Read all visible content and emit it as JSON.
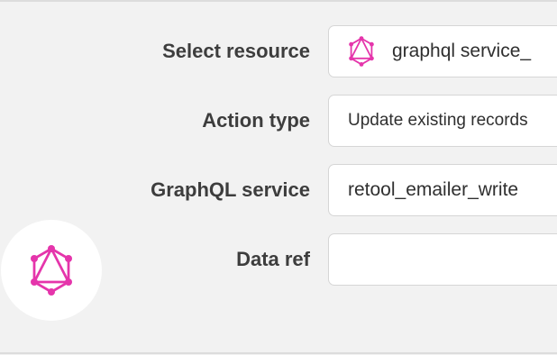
{
  "form": {
    "rows": [
      {
        "label": "Select resource",
        "value": "graphql service_",
        "icon": "graphql-icon"
      },
      {
        "label": "Action type",
        "value": "Update existing records"
      },
      {
        "label": "GraphQL service",
        "value": "retool_emailer_write"
      },
      {
        "label": "Data ref",
        "value": ""
      }
    ]
  },
  "logo": {
    "icon": "graphql-icon",
    "color": "#e535ab"
  },
  "colors": {
    "background": "#f2f2f2",
    "field_background": "#ffffff",
    "field_border": "#d6d6d6",
    "label_text": "#3d3d3d",
    "graphql_pink": "#e535ab"
  }
}
